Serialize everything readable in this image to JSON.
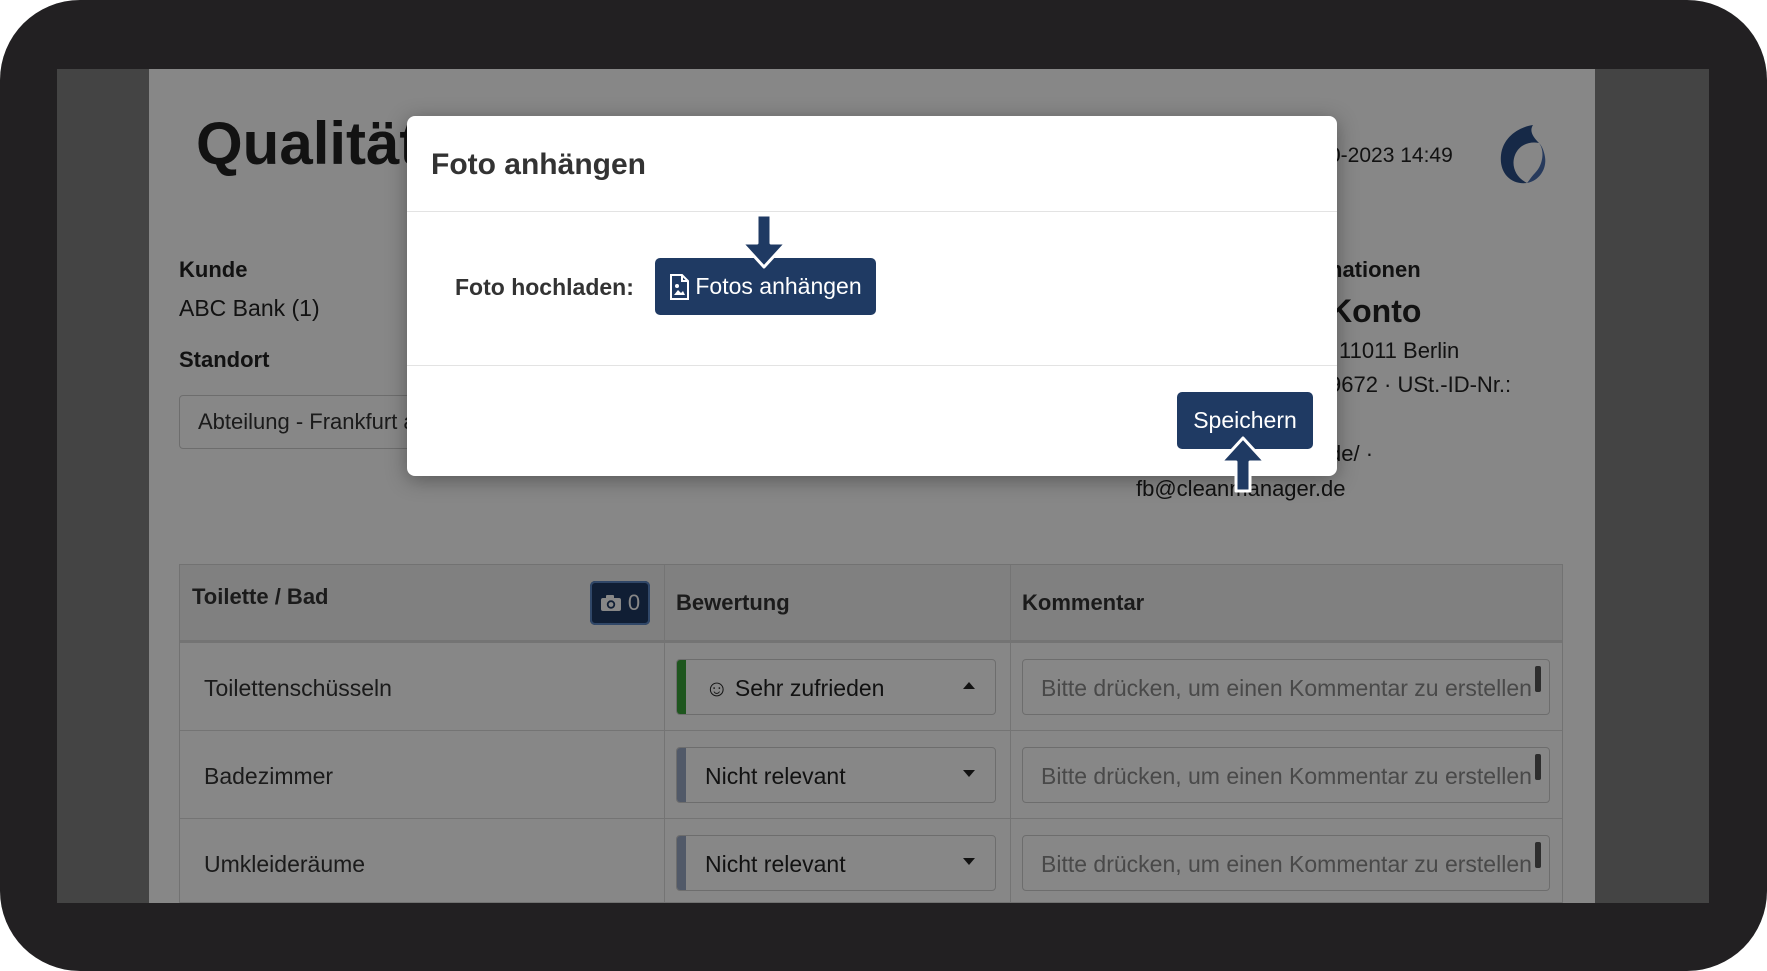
{
  "background_page": {
    "title": "Qualitäts",
    "date": "0-2023 14:49",
    "customer": {
      "label": "Kunde",
      "value": "ABC Bank (1)"
    },
    "location": {
      "label": "Standort",
      "value": "Abteilung - Frankfurt a"
    },
    "company_info": {
      "title": "nationen",
      "name": "Konto",
      "address": "11011 Berlin",
      "tax": "9672 · USt.-ID-Nr.:",
      "website": "de/ ·",
      "email": "fb@cleanmanager.de"
    },
    "table": {
      "category": "Toilette / Bad",
      "photo_count": "0",
      "columns": [
        "Bewertung",
        "Kommentar"
      ],
      "rows": [
        {
          "label": "Toilettenschüsseln",
          "rating_icon": "☺",
          "rating": "Sehr zufrieden",
          "open": true,
          "status_color": "#3aa33a",
          "comment_placeholder": "Bitte drücken, um einen Kommentar zu erstellen"
        },
        {
          "label": "Badezimmer",
          "rating": "Nicht relevant",
          "open": false,
          "status_color": "#9aa8c4",
          "comment_placeholder": "Bitte drücken, um einen Kommentar zu erstellen"
        },
        {
          "label": "Umkleideräume",
          "rating": "Nicht relevant",
          "open": false,
          "status_color": "#9aa8c4",
          "comment_placeholder": "Bitte drücken, um einen Kommentar zu erstellen"
        }
      ]
    }
  },
  "modal": {
    "title": "Foto anhängen",
    "upload_label": "Foto hochladen:",
    "attach_button": "Fotos anhängen",
    "save_button": "Speichern"
  },
  "colors": {
    "primary": "#1f3a63",
    "overlay": "#000000"
  }
}
